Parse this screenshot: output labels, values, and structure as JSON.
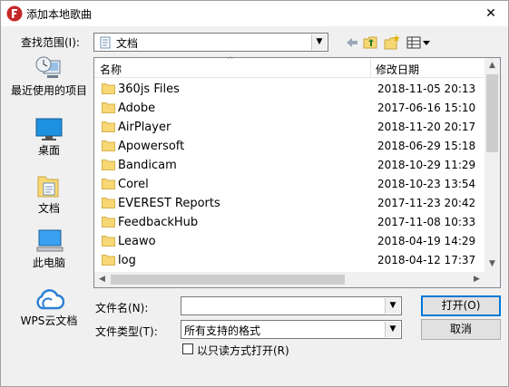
{
  "window": {
    "title": "添加本地歌曲",
    "close_glyph": "✕"
  },
  "lookin": {
    "label": "查找范围(I):",
    "value": "文档"
  },
  "places": [
    {
      "name": "recent",
      "label": "最近使用的项目"
    },
    {
      "name": "desktop",
      "label": "桌面"
    },
    {
      "name": "documents",
      "label": "文档"
    },
    {
      "name": "this-pc",
      "label": "此电脑"
    },
    {
      "name": "wps-cloud",
      "label": "WPS云文档"
    }
  ],
  "filelist": {
    "col_name": "名称",
    "col_date": "修改日期",
    "rows": [
      {
        "name": "360js Files",
        "date": "2018-11-05 20:13"
      },
      {
        "name": "Adobe",
        "date": "2017-06-16 15:10"
      },
      {
        "name": "AirPlayer",
        "date": "2018-11-20 20:17"
      },
      {
        "name": "Apowersoft",
        "date": "2018-06-29 15:18"
      },
      {
        "name": "Bandicam",
        "date": "2018-10-29 11:29"
      },
      {
        "name": "Corel",
        "date": "2018-10-23 13:54"
      },
      {
        "name": "EVEREST Reports",
        "date": "2017-11-23 20:42"
      },
      {
        "name": "FeedbackHub",
        "date": "2017-11-08 10:33"
      },
      {
        "name": "Leawo",
        "date": "2018-04-19 14:29"
      },
      {
        "name": "log",
        "date": "2018-04-12 17:37"
      }
    ]
  },
  "filename": {
    "label": "文件名(N):",
    "value": ""
  },
  "filetype": {
    "label": "文件类型(T):",
    "value": "所有支持的格式"
  },
  "readonly": {
    "label": "以只读方式打开(R)",
    "checked": false
  },
  "buttons": {
    "open": "打开(O)",
    "cancel": "取消"
  },
  "colors": {
    "accent": "#0078d7",
    "folder": "#f8d775",
    "app_icon": "#c62828"
  }
}
